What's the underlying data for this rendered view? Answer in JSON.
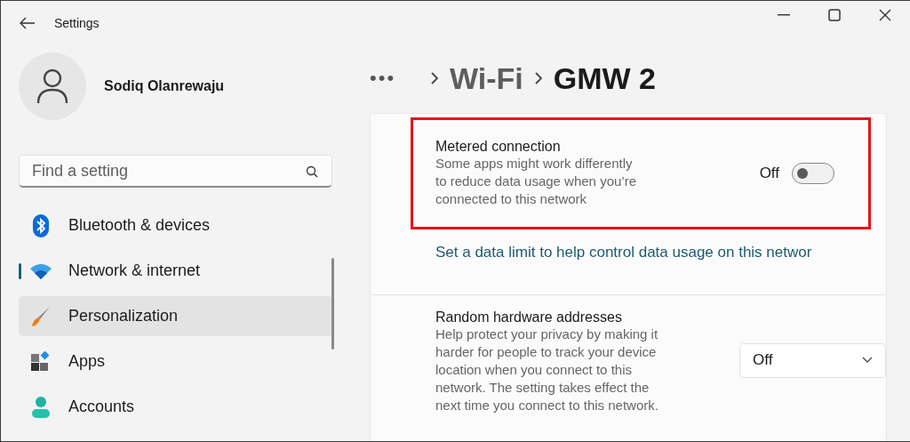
{
  "window": {
    "title": "Settings"
  },
  "profile": {
    "name": "Sodiq Olanrewaju"
  },
  "search": {
    "placeholder": "Find a setting"
  },
  "nav": [
    {
      "label": "Bluetooth & devices",
      "selected": false,
      "hovered": false
    },
    {
      "label": "Network & internet",
      "selected": true,
      "hovered": false
    },
    {
      "label": "Personalization",
      "selected": false,
      "hovered": true
    },
    {
      "label": "Apps",
      "selected": false,
      "hovered": false
    },
    {
      "label": "Accounts",
      "selected": false,
      "hovered": false
    }
  ],
  "breadcrumb": {
    "overflow": "•••",
    "items": [
      "Wi-Fi",
      "GMW 2"
    ]
  },
  "metered": {
    "title": "Metered connection",
    "description": "Some apps might work differently to reduce data usage when you’re connected to this network",
    "state_label": "Off",
    "on": false,
    "highlighted": true
  },
  "data_limit_link": "Set a data limit to help control data usage on this networ",
  "random_hw": {
    "title": "Random hardware addresses",
    "description": "Help protect your privacy by making it harder for people to track your device location when you connect to this network. The setting takes effect the next time you connect to this network.",
    "value": "Off"
  }
}
